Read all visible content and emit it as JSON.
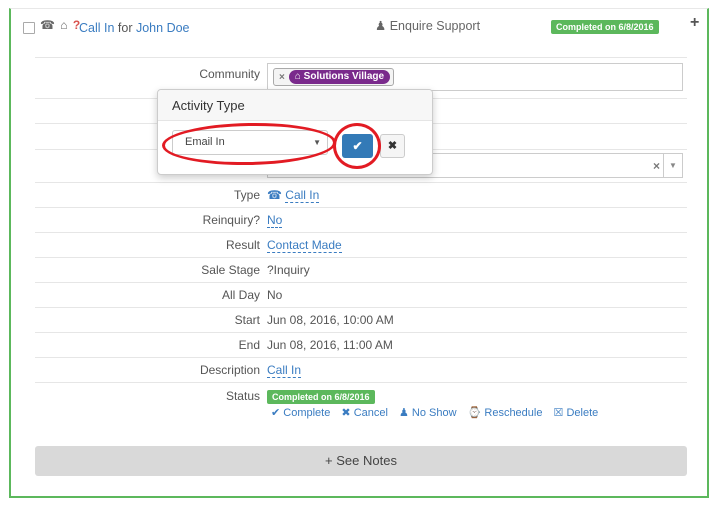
{
  "header": {
    "icons": "☎ ⌂",
    "question_mark": "?",
    "title_prefix": "Call In",
    "title_for": " for ",
    "contact_name": "John Doe",
    "support_icon": "♟",
    "support_label": "Enquire Support",
    "status_badge": "Completed on 6/8/2016",
    "expand": "+"
  },
  "fields": {
    "community_label": "Community",
    "community_tag_remove": "×",
    "community_tag": "⌂ Solutions Village",
    "type_label": "Type",
    "type_icon": "☎",
    "type_value": "Call In",
    "reinquiry_label": "Reinquiry?",
    "reinquiry_value": "No",
    "result_label": "Result",
    "result_value": "Contact Made",
    "sale_stage_label": "Sale Stage",
    "sale_stage_value": "?Inquiry",
    "all_day_label": "All Day",
    "all_day_value": "No",
    "start_label": "Start",
    "start_value": "Jun 08, 2016, 10:00 AM",
    "end_label": "End",
    "end_value": "Jun 08, 2016, 11:00 AM",
    "description_label": "Description",
    "description_value": "Call In",
    "status_label": "Status",
    "status_badge": "Completed on 6/8/2016"
  },
  "select2": {
    "clear": "×",
    "arrow": "▼"
  },
  "popover": {
    "title": "Activity Type",
    "selected": "Email In",
    "caret": "▼",
    "ok": "✔",
    "cancel": "✖"
  },
  "status_actions": {
    "complete": "✔ Complete",
    "cancel": "✖ Cancel",
    "no_show": "♟ No Show",
    "reschedule": "⌚ Reschedule",
    "delete": "☒ Delete"
  },
  "footer": {
    "see_notes": "+ See Notes"
  },
  "colors": {
    "success": "#5cb85c",
    "primary": "#337ab7",
    "link": "#3a7cc1",
    "community_tag": "#7a2a8c",
    "annotation": "#e21b23"
  }
}
